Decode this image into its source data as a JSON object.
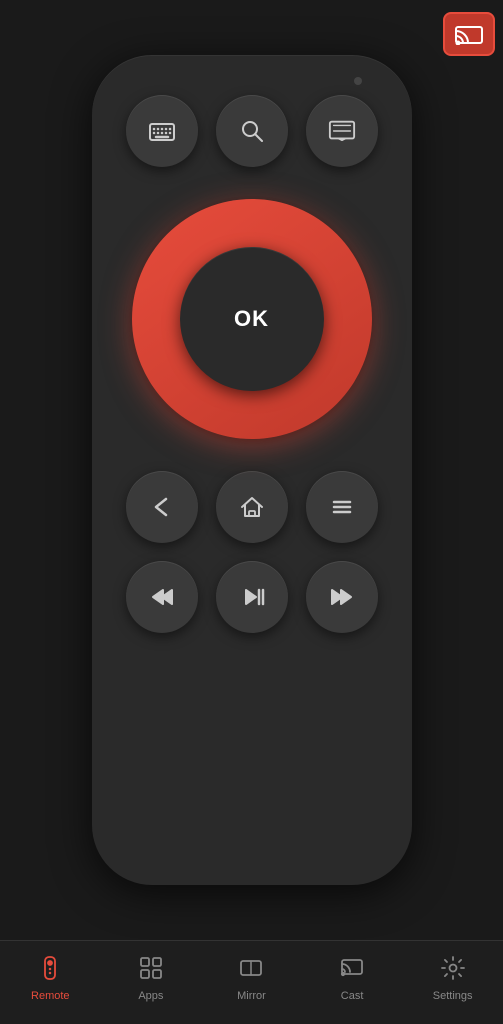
{
  "topBar": {
    "castButton": {
      "label": "Cast",
      "active": true
    }
  },
  "remote": {
    "topButtons": [
      {
        "id": "keyboard",
        "icon": "keyboard-icon"
      },
      {
        "id": "search",
        "icon": "search-icon"
      },
      {
        "id": "display",
        "icon": "display-icon"
      }
    ],
    "okLabel": "OK",
    "midButtons": [
      {
        "id": "back",
        "icon": "back-icon"
      },
      {
        "id": "home",
        "icon": "home-icon"
      },
      {
        "id": "menu",
        "icon": "menu-icon"
      }
    ],
    "mediaButtons": [
      {
        "id": "rewind",
        "icon": "rewind-icon"
      },
      {
        "id": "play-pause",
        "icon": "play-pause-icon"
      },
      {
        "id": "fast-forward",
        "icon": "fast-forward-icon"
      }
    ]
  },
  "bottomNav": {
    "items": [
      {
        "id": "remote",
        "label": "Remote",
        "active": true
      },
      {
        "id": "apps",
        "label": "Apps",
        "active": false
      },
      {
        "id": "mirror",
        "label": "Mirror",
        "active": false
      },
      {
        "id": "cast",
        "label": "Cast",
        "active": false
      },
      {
        "id": "settings",
        "label": "Settings",
        "active": false
      }
    ]
  }
}
